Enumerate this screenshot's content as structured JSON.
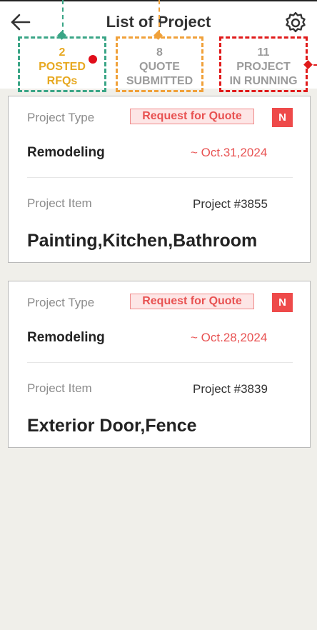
{
  "header": {
    "title": "List of Project",
    "back_icon": "arrow-left-icon",
    "settings_icon": "gear-icon"
  },
  "tabs": [
    {
      "count": "2",
      "line1": "POSTED",
      "line2": "RFQs",
      "has_dot": true,
      "color": "#e7a820"
    },
    {
      "count": "8",
      "line1": "QUOTE",
      "line2": "SUBMITTED",
      "color": "#9b9b9b"
    },
    {
      "count": "11",
      "line1": "PROJECT",
      "line2": "IN RUNNING",
      "color": "#9b9b9b"
    }
  ],
  "cards": [
    {
      "type_label": "Project Type",
      "status": "Request for Quote",
      "new_badge": "N",
      "type_value": "Remodeling",
      "due": "~ Oct.31,2024",
      "item_label": "Project Item",
      "project_no": "Project #3855",
      "items": "Painting,Kitchen,Bathroom"
    },
    {
      "type_label": "Project Type",
      "status": "Request for Quote",
      "new_badge": "N",
      "type_value": "Remodeling",
      "due": "~ Oct.28,2024",
      "item_label": "Project Item",
      "project_no": "Project #3839",
      "items": "Exterior Door,Fence"
    }
  ],
  "colors": {
    "accent_red": "#e85252",
    "highlight_green": "#3aa586",
    "highlight_orange": "#f0a13a",
    "highlight_red": "#e01a1a"
  }
}
